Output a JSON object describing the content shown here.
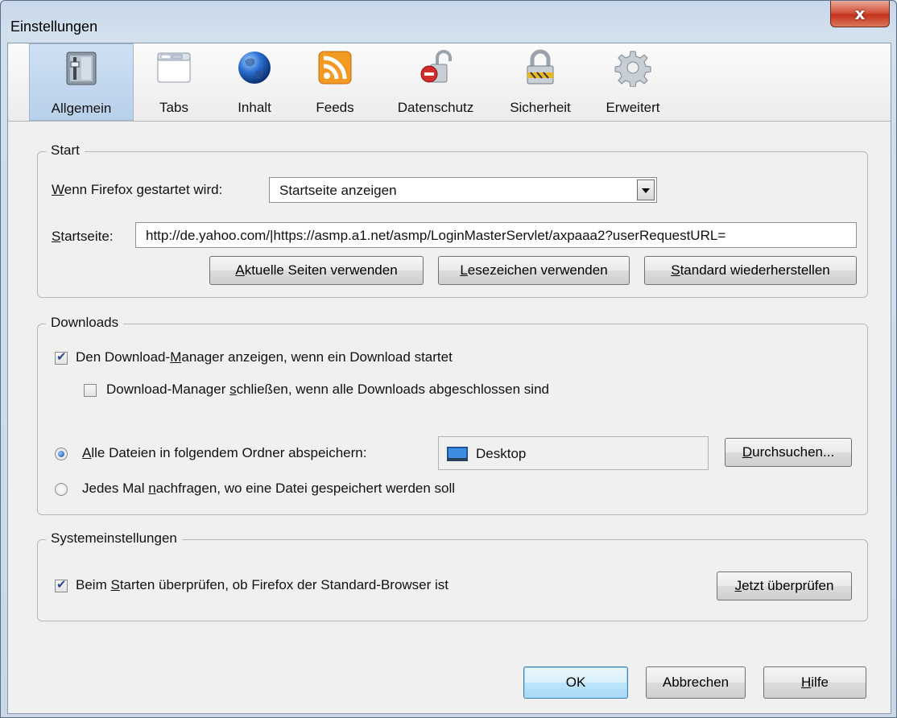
{
  "window": {
    "title": "Einstellungen",
    "close_glyph": "x"
  },
  "toolbar": {
    "items": [
      {
        "label": "Allgemein",
        "icon": "general-switch-icon",
        "active": true
      },
      {
        "label": "Tabs",
        "icon": "tabs-window-icon"
      },
      {
        "label": "Inhalt",
        "icon": "globe-icon"
      },
      {
        "label": "Feeds",
        "icon": "rss-feed-icon"
      },
      {
        "label": "Datenschutz",
        "icon": "privacy-unlocked-lock-icon"
      },
      {
        "label": "Sicherheit",
        "icon": "security-padlock-icon"
      },
      {
        "label": "Erweitert",
        "icon": "gear-icon"
      }
    ]
  },
  "start": {
    "legend": "Start",
    "when_label_pre": "W",
    "when_label_post": "enn Firefox gestartet wird:",
    "when_value": "Startseite anzeigen",
    "homepage_label_pre": "S",
    "homepage_label_post": "tartseite:",
    "homepage_value": "http://de.yahoo.com/|https://asmp.a1.net/asmp/LoginMasterServlet/axpaaa2?userRequestURL=",
    "btn_current_pre": "A",
    "btn_current_post": "ktuelle Seiten verwenden",
    "btn_bookmark_pre": "L",
    "btn_bookmark_post": "esezeichen verwenden",
    "btn_restore_pre": "S",
    "btn_restore_post": "tandard wiederherstellen"
  },
  "downloads": {
    "legend": "Downloads",
    "show_manager_pre": "Den Download-",
    "show_manager_u": "M",
    "show_manager_post": "anager anzeigen, wenn ein Download startet",
    "show_manager_checked": true,
    "close_manager_pre": "Download-Manager ",
    "close_manager_u": "s",
    "close_manager_post": "chließen, wenn alle Downloads abgeschlossen sind",
    "close_manager_checked": false,
    "save_all_pre": "",
    "save_all_u": "A",
    "save_all_post": "lle Dateien in folgendem Ordner abspeichern:",
    "save_all_selected": true,
    "folder_name": "Desktop",
    "browse_pre": "D",
    "browse_post": "urchsuchen...",
    "ask_pre": "Jedes Mal ",
    "ask_u": "n",
    "ask_post": "achfragen, wo eine Datei gespeichert werden soll",
    "ask_selected": false
  },
  "system": {
    "legend": "Systemeinstellungen",
    "check_default_pre": "Beim ",
    "check_default_u": "S",
    "check_default_post": "tarten überprüfen, ob Firefox der Standard-Browser ist",
    "check_default_checked": true,
    "btn_check_pre": "J",
    "btn_check_post": "etzt überprüfen"
  },
  "footer": {
    "ok": "OK",
    "cancel": "Abbrechen",
    "help_pre": "H",
    "help_post": "ilfe"
  }
}
